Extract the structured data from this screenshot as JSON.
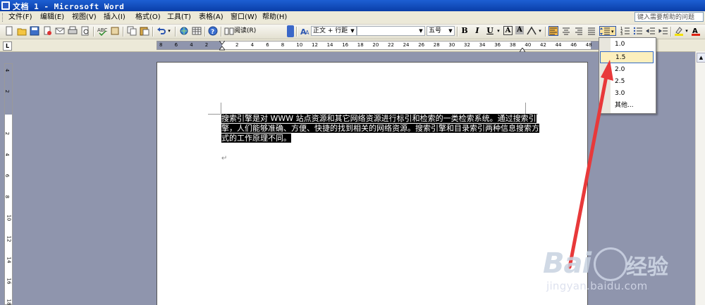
{
  "window": {
    "title": "文档 1 - Microsoft Word"
  },
  "menubar": {
    "items": [
      "文件(F)",
      "编辑(E)",
      "视图(V)",
      "插入(I)",
      "格式(O)",
      "工具(T)",
      "表格(A)",
      "窗口(W)",
      "帮助(H)"
    ],
    "help_placeholder": "键入需要帮助的问题"
  },
  "toolbar": {
    "read_label": "阅读(R)",
    "style_value": "正文 + 行距",
    "font_value": "",
    "size_value": "五号",
    "bold_label": "B",
    "italic_label": "I",
    "underline_label": "U",
    "font_color_label": "A",
    "char_shade_label": "A"
  },
  "ruler": {
    "tab_selector": "L",
    "ticks": [
      "8",
      "6",
      "4",
      "2",
      "",
      "2",
      "4",
      "6",
      "8",
      "10",
      "12",
      "14",
      "16",
      "18",
      "20",
      "22",
      "24",
      "26",
      "28",
      "30",
      "32",
      "34",
      "36",
      "38",
      "40",
      "42",
      "44",
      "46",
      "48"
    ],
    "vticks": [
      "4",
      "2",
      "",
      "2",
      "4",
      "6",
      "8",
      "10",
      "12",
      "14",
      "16",
      "18"
    ]
  },
  "document": {
    "selected_text": "搜索引擎是对 WWW 站点资源和其它网络资源进行标引和检索的一类检索系统。通过搜索引擎，人们能够准确、方便、快捷的找到相关的网络资源。搜索引擎和目录索引两种信息搜索方式的工作原理不同。",
    "return_mark": "↵"
  },
  "line_spacing_menu": {
    "options": [
      "1.0",
      "1.5",
      "2.0",
      "2.5",
      "3.0",
      "其他..."
    ],
    "highlighted": "1.5"
  },
  "watermark": {
    "brand": "Bai",
    "brand_cn": "经验",
    "url": "jingyan.baidu.com"
  },
  "colors": {
    "titlebar": "#0a3ea8",
    "workspace": "#8f95ad",
    "arrow": "#e8393a",
    "menu_highlight": "#fcefbd"
  }
}
